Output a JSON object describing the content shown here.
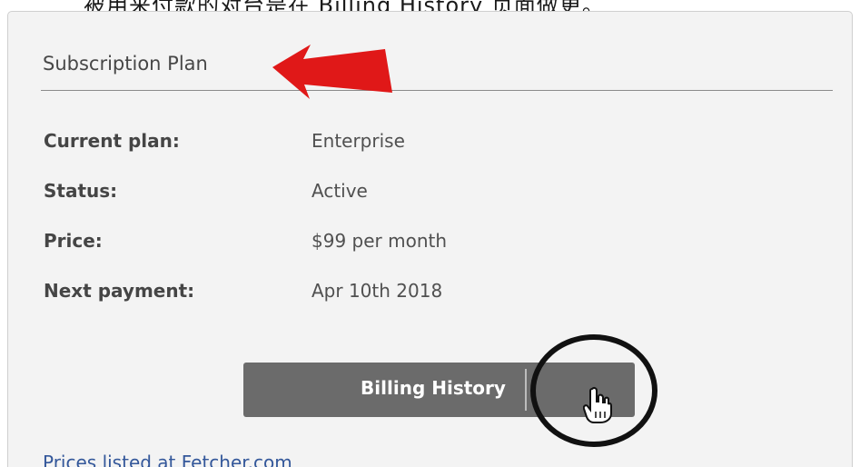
{
  "header_fragment": "被用来付款的对台是在 Billing History 页面做更。",
  "panel": {
    "title": "Subscription Plan"
  },
  "plan_details": {
    "current_plan_label": "Current plan:",
    "current_plan_value": "Enterprise",
    "status_label": "Status:",
    "status_value": "Active",
    "price_label": "Price:",
    "price_value": "$99 per month",
    "next_payment_label": "Next payment:",
    "next_payment_value": "Apr 10th 2018"
  },
  "buttons": {
    "billing_history_label": "Billing History"
  },
  "footer": {
    "prices_link_text": "Prices listed at Fetcher.com"
  },
  "icons": {
    "annotation_arrow": "red-arrow-icon",
    "annotation_circle": "circle-highlight-icon",
    "pointer": "hand-pointer-icon"
  },
  "colors": {
    "panel_background": "#f3f3f3",
    "button_background": "#6b6b6b",
    "link": "#33579a",
    "arrow": "#e01818"
  }
}
